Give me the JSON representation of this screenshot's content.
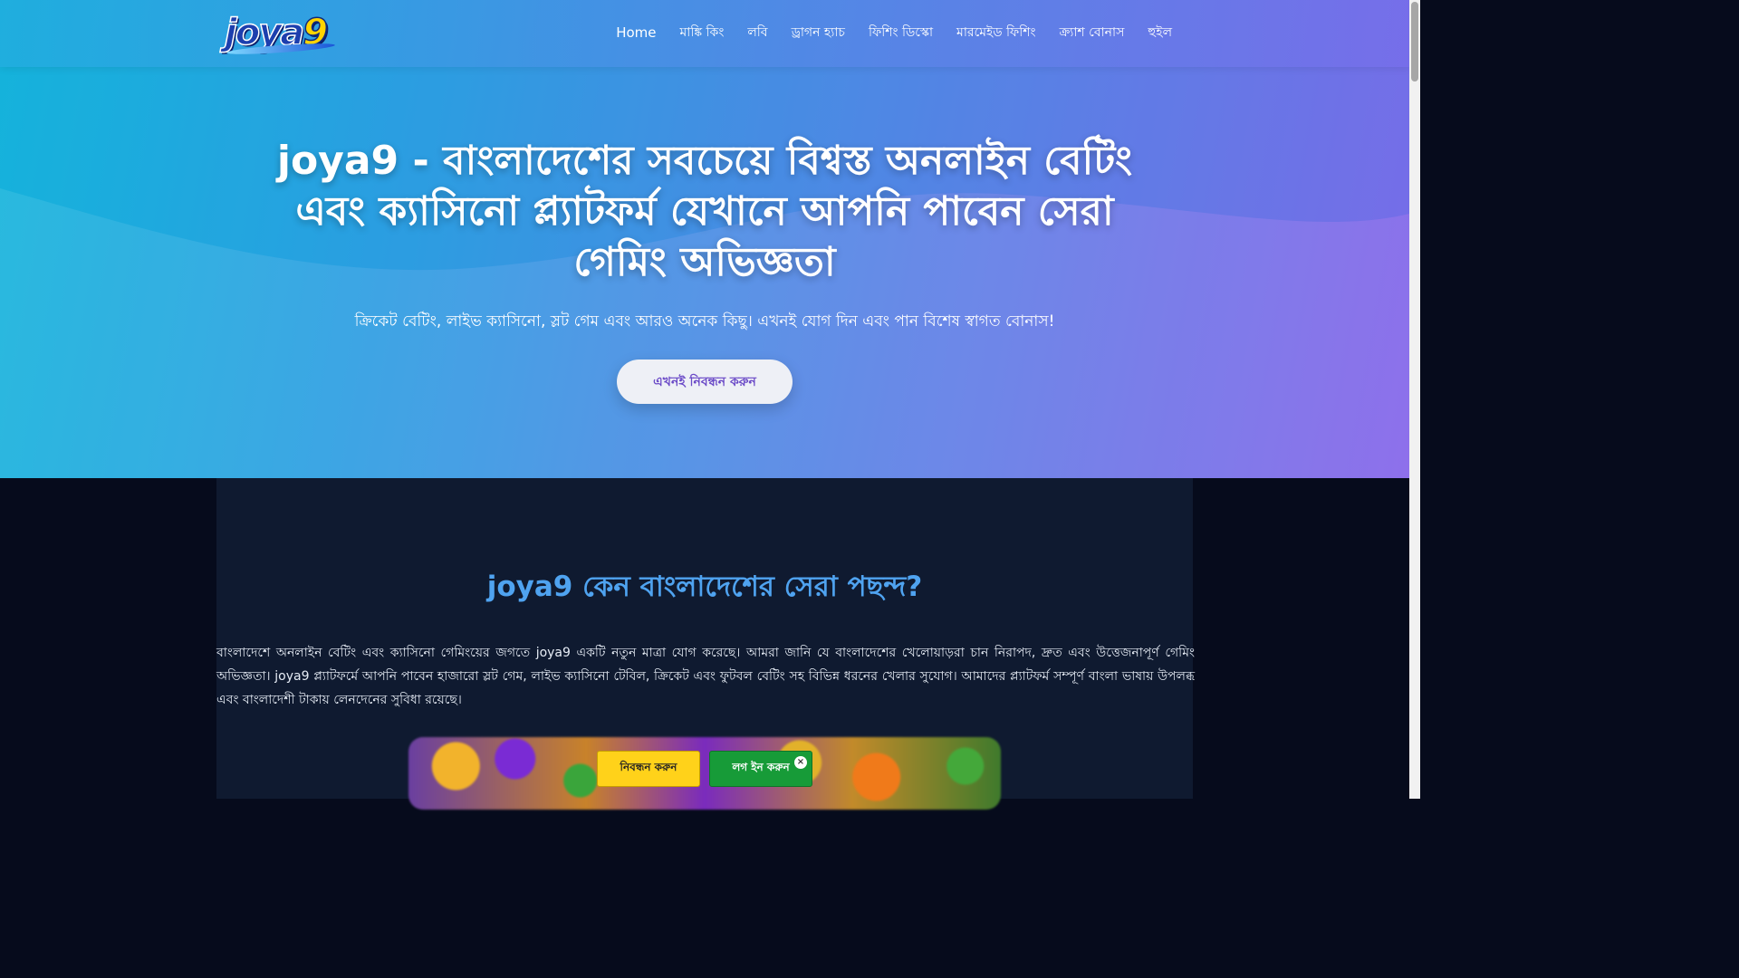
{
  "brand": {
    "logo_text": "joya",
    "logo_digit": "9"
  },
  "nav": {
    "items": [
      {
        "label": "Home"
      },
      {
        "label": "মাঙ্কি কিং"
      },
      {
        "label": "লবি"
      },
      {
        "label": "ড্রাগন হ্যাচ"
      },
      {
        "label": "ফিশিং ডিস্কো"
      },
      {
        "label": "মারমেইড ফিশিং"
      },
      {
        "label": "ক্র্যাশ বোনাস"
      },
      {
        "label": "হুইল"
      }
    ]
  },
  "hero": {
    "title": "joya9 - বাংলাদেশের সবচেয়ে বিশ্বস্ত অনলাইন বেটিং এবং ক্যাসিনো প্ল্যাটফর্ম যেখানে আপনি পাবেন সেরা গেমিং অভিজ্ঞতা",
    "subtitle": "ক্রিকেট বেটিং, লাইভ ক্যাসিনো, স্লট গেম এবং আরও অনেক কিছু। এখনই যোগ দিন এবং পান বিশেষ স্বাগত বোনাস!",
    "cta_label": "এখনই নিবন্ধন করুন"
  },
  "section": {
    "title": "joya9 কেন বাংলাদেশের সেরা পছন্দ?",
    "paragraph": "বাংলাদেশে অনলাইন বেটিং এবং ক্যাসিনো গেমিংয়ের জগতে joya9 একটি নতুন মাত্রা যোগ করেছে। আমরা জানি যে বাংলাদেশের খেলোয়াড়রা চান নিরাপদ, দ্রুত এবং উত্তেজনাপূর্ণ গেমিং অভিজ্ঞতা। joya9 প্ল্যাটফর্মে আপনি পাবেন হাজারো স্লট গেম, লাইভ ক্যাসিনো টেবিল, ক্রিকেট এবং ফুটবল বেটিং সহ বিভিন্ন ধরনের খেলার সুযোগ। আমাদের প্ল্যাটফর্ম সম্পূর্ণ বাংলা ভাষায় উপলব্ধ এবং বাংলাদেশী টাকায় লেনদেনের সুবিধা রয়েছে।"
  },
  "sticky": {
    "register_label": "নিবন্ধন করুন",
    "login_label": "লগ ইন করুন",
    "close_label": "×"
  },
  "colors": {
    "hero_start": "#17b6dc",
    "hero_end": "#8666ea",
    "section_title": "#4fa3f0",
    "register_bg": "#ffd21a",
    "login_bg": "#179b38",
    "page_bg": "#060b1c"
  }
}
